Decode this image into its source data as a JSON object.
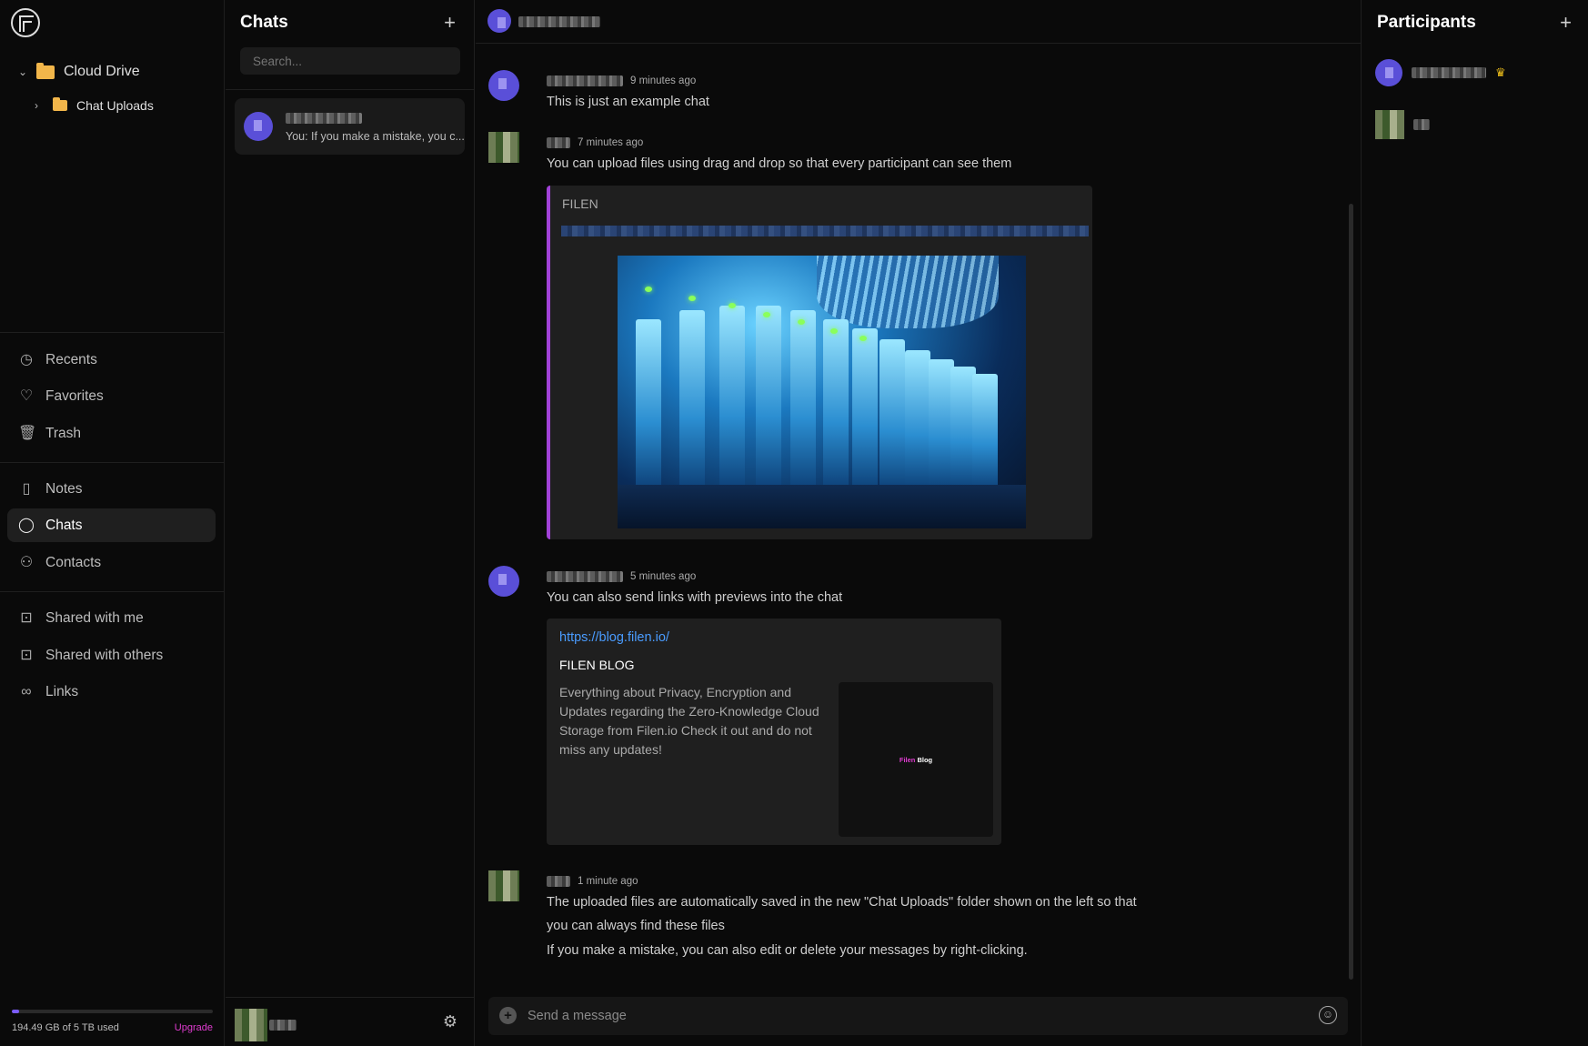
{
  "sidebar": {
    "tree": [
      {
        "label": "Cloud Drive",
        "expanded": true
      },
      {
        "label": "Chat Uploads",
        "expanded": false
      }
    ],
    "nav_group_1": [
      {
        "icon": "clock-icon",
        "label": "Recents"
      },
      {
        "icon": "heart-icon",
        "label": "Favorites"
      },
      {
        "icon": "trash-icon",
        "label": "Trash"
      }
    ],
    "nav_group_2": [
      {
        "icon": "book-icon",
        "label": "Notes"
      },
      {
        "icon": "chat-bubble-icon",
        "label": "Chats",
        "active": true
      },
      {
        "icon": "users-icon",
        "label": "Contacts"
      }
    ],
    "nav_group_3": [
      {
        "icon": "folder-share-icon",
        "label": "Shared with me"
      },
      {
        "icon": "folder-share-icon",
        "label": "Shared with others"
      },
      {
        "icon": "link-icon",
        "label": "Links"
      }
    ],
    "storage": {
      "used_text": "194.49 GB of 5 TB used",
      "upgrade_label": "Upgrade",
      "used_fraction": 0.038
    }
  },
  "chatlist": {
    "title": "Chats",
    "search_placeholder": "Search...",
    "conversation": {
      "preview": "You:  If you make a mistake, you c..."
    }
  },
  "messages": [
    {
      "time": "9 minutes ago",
      "text": "This is just an example chat"
    },
    {
      "time": "7 minutes ago",
      "text": "You can upload files using drag and drop so that every participant can see them",
      "embed_title": "FILEN"
    },
    {
      "time": "5 minutes ago",
      "text": "You can also send links with previews into the chat",
      "link": {
        "url": "https://blog.filen.io/",
        "title": "FILEN BLOG",
        "description": "Everything about Privacy, Encryption and Updates regarding the Zero-Knowledge Cloud Storage from Filen.io Check it out and do not miss any updates!",
        "thumb_brand": "Filen",
        "thumb_word": "Blog"
      }
    },
    {
      "time": "1 minute ago",
      "lines": [
        "The uploaded files are automatically saved in the new \"Chat Uploads\" folder shown on the left so that",
        "you can always find these files",
        "If you make a mistake, you can also edit or delete your messages by right-clicking."
      ]
    }
  ],
  "composer": {
    "placeholder": "Send a message"
  },
  "participants": {
    "title": "Participants"
  },
  "colors": {
    "accent": "#7b5cff",
    "upgrade": "#e03cd0",
    "link": "#4a9cff",
    "embed_bar": "#a142d8",
    "crown": "#f2c21b"
  }
}
